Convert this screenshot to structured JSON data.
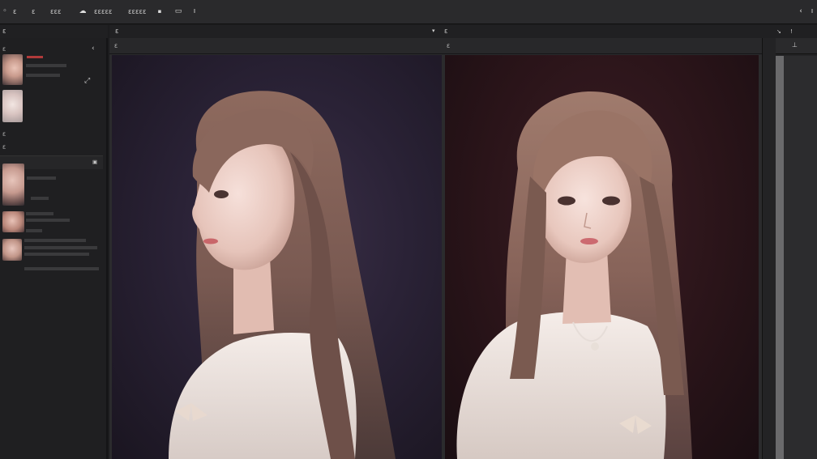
{
  "menubar": {
    "items": [
      "Ɛ",
      "Ɛ",
      "ƐƐƐ",
      "ƐƐƐƐƐ",
      "ƐƐƐƐƐ"
    ],
    "icons": [
      "app-icon",
      "cloud-icon",
      "image-icon",
      "info-icon",
      "chevron-left-icon",
      "pin-icon"
    ]
  },
  "headers": {
    "left_panel": "Ɛ",
    "center_panel": "Ɛ",
    "right_panel": "Ɛ"
  },
  "sidebar": {
    "section1_title": "Ɛ",
    "section2_title": "Ɛ",
    "section3_title": "Ɛ"
  },
  "viewports": {
    "left_label": "Ɛ",
    "right_label": "Ɛ"
  }
}
